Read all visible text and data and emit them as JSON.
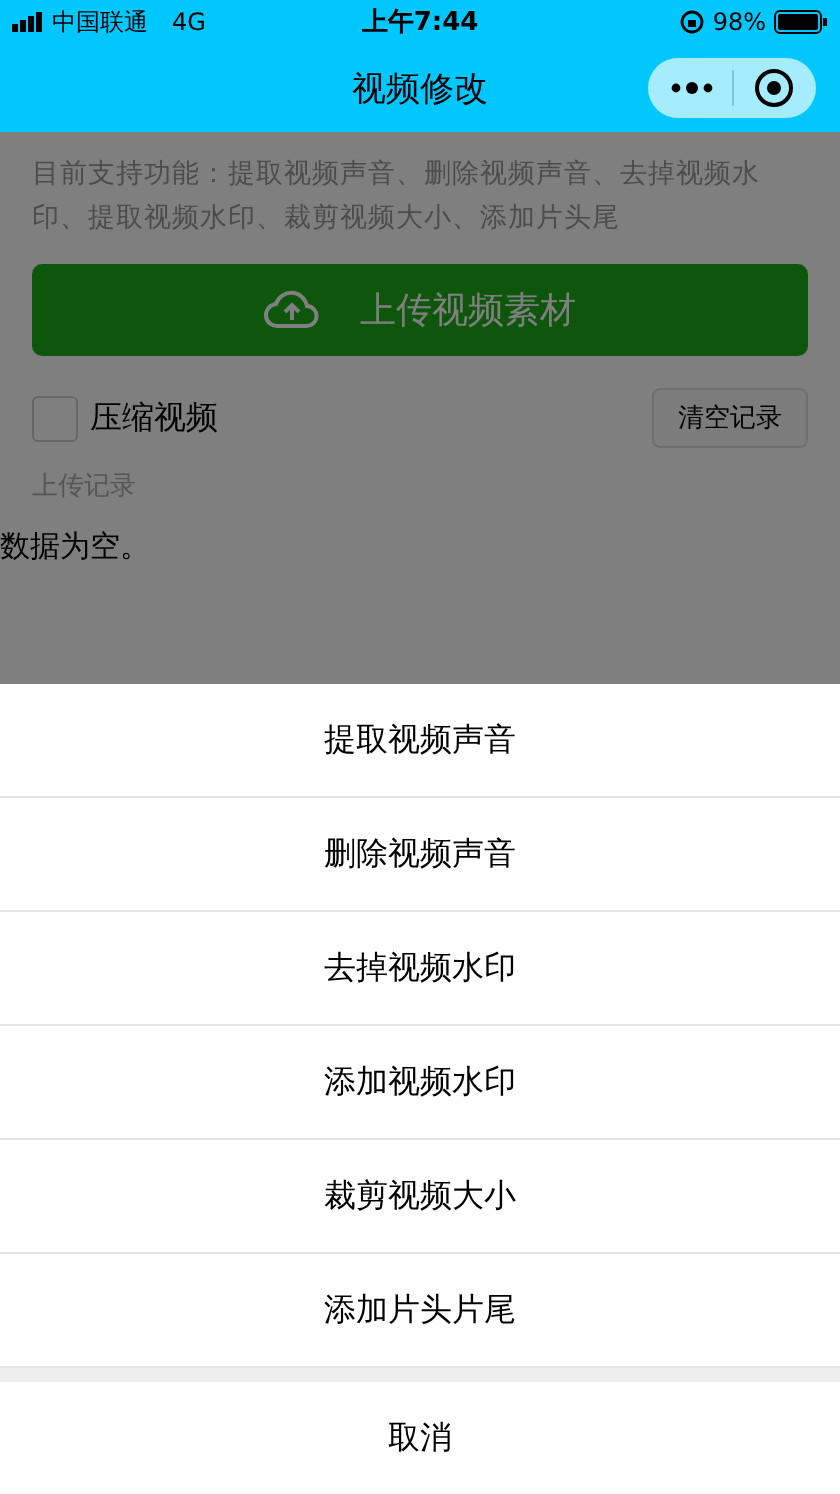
{
  "status_bar": {
    "carrier": "中国联通",
    "network": "4G",
    "time": "上午7:44",
    "battery": "98%"
  },
  "nav_bar": {
    "title": "视频修改"
  },
  "page": {
    "intro": "目前支持功能：提取视频声音、删除视频声音、去掉视频水印、提取视频水印、裁剪视频大小、添加片头尾",
    "upload_button": "上传视频素材",
    "compress": {
      "label": "压缩视频",
      "checked": false
    },
    "clear_button": "清空记录",
    "records_label": "上传记录",
    "empty_text": "数据为空。"
  },
  "action_sheet": {
    "items": [
      {
        "label": "提取视频声音"
      },
      {
        "label": "删除视频声音"
      },
      {
        "label": "去掉视频水印"
      },
      {
        "label": "添加视频水印"
      },
      {
        "label": "裁剪视频大小"
      },
      {
        "label": "添加片头片尾"
      }
    ],
    "cancel": "取消"
  }
}
